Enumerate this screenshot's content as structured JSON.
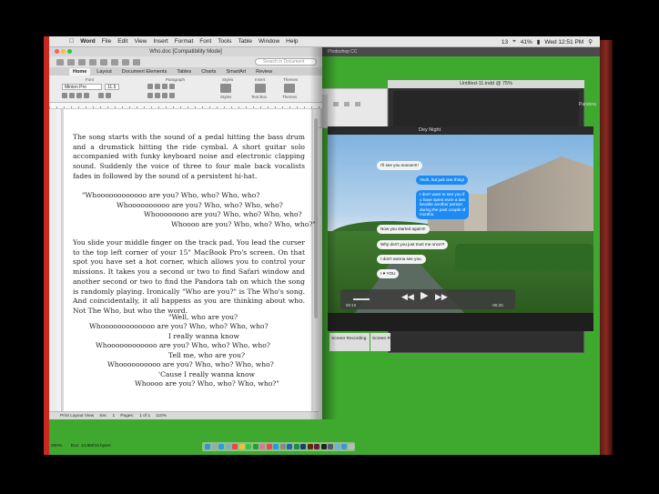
{
  "menubar": {
    "app": "Word",
    "items": [
      "File",
      "Edit",
      "View",
      "Insert",
      "Format",
      "Font",
      "Tools",
      "Table",
      "Window",
      "Help"
    ],
    "status_count": "13",
    "battery": "41%",
    "clock": "Wed 12:51 PM"
  },
  "word": {
    "title": "Who.doc [Compatibility Mode]",
    "search_placeholder": "Search in Document",
    "tabs": [
      "Home",
      "Layout",
      "Document Elements",
      "Tables",
      "Charts",
      "SmartArt",
      "Review"
    ],
    "ribbon_groups": {
      "font": "Font",
      "paragraph": "Paragraph",
      "styles": "Styles",
      "insert": "Insert",
      "themes": "Themes"
    },
    "ribbon_labels": {
      "styles": "Styles",
      "text_box": "Text Box",
      "themes": "Themes"
    },
    "font_name": "Minion Pro",
    "font_size": "11.5",
    "paragraphs": [
      "The song starts with the sound of a pedal hitting the bass drum and a drumstick hitting the ride cymbal. A short guitar solo accompanied with funky keyboard noise and electronic clapping sound. Suddenly the voice of three to four male back vocalists fades in followed by the sound of a persistent hi-hat.",
      "You slide your middle finger on the track pad. You lead the curser to the top left corner of your 15\" MacBook Pro's screen. On that spot you have set a hot corner, which allows you to control your missions. It takes you a second or two to find Safari window and another second or two to find the Pandora tab on which the song is randomly playing. Ironically \"Who are you?\" is The Who's song. And coincidentally, it all happens as you are thinking about who. Not The Who, but who the word."
    ],
    "lyrics1": [
      "\"Whoooooooooooo are you? Who, who? Who, who?",
      "Whoooooooooo are you? Who, who? Who, who?",
      "Whoooooooo are you? Who, who? Who, who?",
      "Whoooo are you? Who, who? Who, who?\""
    ],
    "lyrics2": [
      "\"Well, who are you?",
      "Whooooooooooooo are you? Who, who? Who, who?",
      "I really wanna know",
      "Whoooooooooooo are you? Who, who? Who, who?",
      "Tell me, who are you?",
      "Whoooooooooo are you? Who, who? Who, who?",
      "'Cause I really wanna know",
      "Whoooo are you? Who, who? Who, who?\""
    ],
    "status": {
      "view": "Print Layout View",
      "sec_label": "Sec",
      "sec": "1",
      "pages_label": "Pages:",
      "pages": "1 of 1",
      "zoom": "110%"
    }
  },
  "right": {
    "ps_title": "Photoshop CC",
    "untitled_title": "Untitled-11.indd @ 75%",
    "pandora": "Pandora",
    "video_title": "Dey Night",
    "bubbles": [
      {
        "text": "I'll see you soooon!!!",
        "style": "white"
      },
      {
        "text": "Yeah, but just one thing!",
        "style": "blue"
      },
      {
        "text": "I don't want to see you if",
        "style": "blue"
      },
      {
        "text": "u have spent even a last",
        "style": "blue"
      },
      {
        "text": "beatiite another person",
        "style": "blue"
      },
      {
        "text": "during the past couple of",
        "style": "blue"
      },
      {
        "text": "months.",
        "style": "blue"
      },
      {
        "text": "Now you started again!!!",
        "style": "white"
      },
      {
        "text": "Why don't you just trust me once?!",
        "style": "white"
      },
      {
        "text": "I don't wanna see you.",
        "style": "white"
      },
      {
        "text": "I ♥ YOU",
        "style": "white"
      }
    ],
    "time_elapsed": "00:10",
    "time_remaining": "-05:25",
    "finder_items": [
      "Screen Recording",
      "Screen R"
    ]
  },
  "bottom": {
    "zoom": "200%",
    "doc_info": "Doc: 14.8M/15 bytes"
  }
}
